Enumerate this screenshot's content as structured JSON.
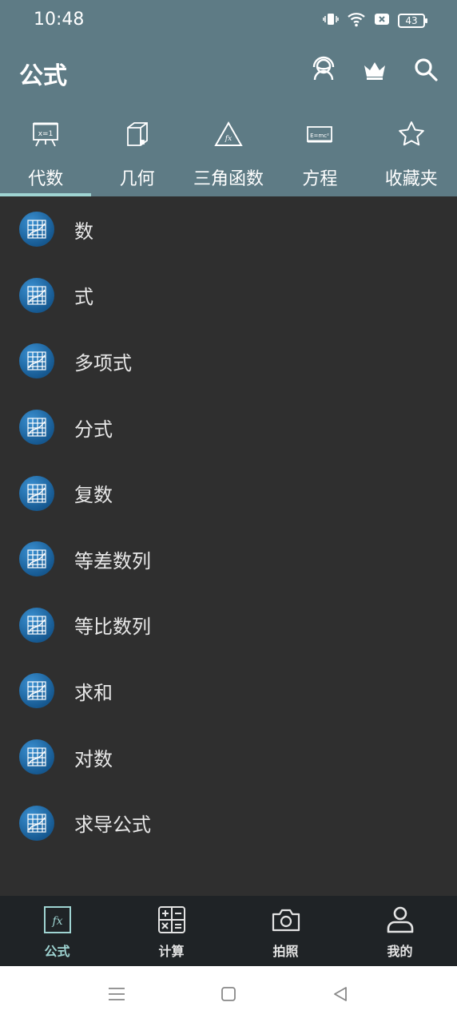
{
  "status_bar": {
    "time": "10:48",
    "battery": "43"
  },
  "app_bar": {
    "title": "公式",
    "actions": [
      "support-icon",
      "crown-icon",
      "search-icon"
    ]
  },
  "tabs": [
    {
      "label": "代数",
      "icon": "algebra-board-icon",
      "active": true
    },
    {
      "label": "几何",
      "icon": "cube-icon",
      "active": false
    },
    {
      "label": "三角函数",
      "icon": "triangle-fx-icon",
      "active": false
    },
    {
      "label": "方程",
      "icon": "equation-board-icon",
      "active": false
    },
    {
      "label": "收藏夹",
      "icon": "star-icon",
      "active": false
    }
  ],
  "list": [
    {
      "label": "数"
    },
    {
      "label": "式"
    },
    {
      "label": "多项式"
    },
    {
      "label": "分式"
    },
    {
      "label": "复数"
    },
    {
      "label": "等差数列"
    },
    {
      "label": "等比数列"
    },
    {
      "label": "求和"
    },
    {
      "label": "对数"
    },
    {
      "label": "求导公式"
    }
  ],
  "bottom_nav": [
    {
      "label": "公式",
      "icon": "fx-icon",
      "active": true
    },
    {
      "label": "计算",
      "icon": "calculator-icon",
      "active": false
    },
    {
      "label": "拍照",
      "icon": "camera-icon",
      "active": false
    },
    {
      "label": "我的",
      "icon": "user-icon",
      "active": false
    }
  ],
  "colors": {
    "header": "#5e7b85",
    "list_background": "#2f2f2f",
    "bottom_nav": "#1f2326",
    "accent": "#9fd4d2",
    "badge": "#175a92"
  }
}
